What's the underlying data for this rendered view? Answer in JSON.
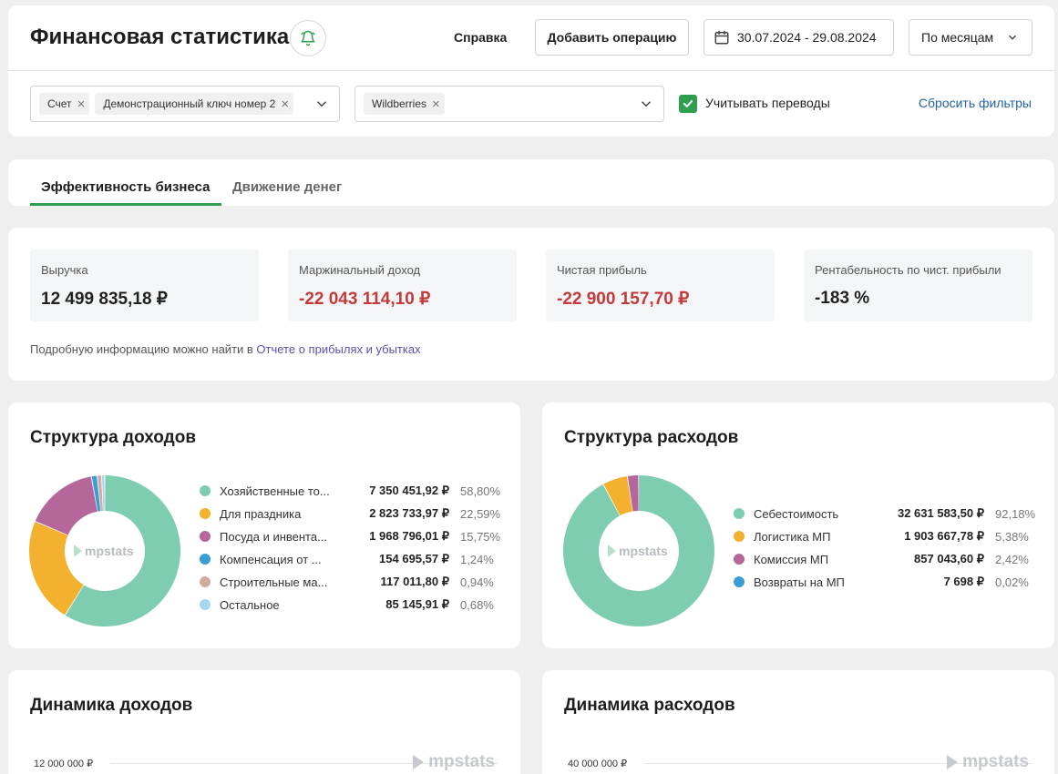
{
  "header": {
    "title": "Финансовая статистика",
    "help_label": "Справка",
    "add_label": "Добавить операцию",
    "date_range": "30.07.2024 - 29.08.2024",
    "period": "По месяцам"
  },
  "filters": {
    "account_tags": [
      "Счет",
      "Демонстрационный ключ номер 2"
    ],
    "marketplace_tags": [
      "Wildberries"
    ],
    "transfers_label": "Учитывать переводы",
    "transfers_checked": true,
    "reset_label": "Сбросить фильтры"
  },
  "tabs": [
    {
      "label": "Эффективность бизнеса",
      "active": true
    },
    {
      "label": "Движение денег",
      "active": false
    }
  ],
  "kpi": [
    {
      "label": "Выручка",
      "value": "12 499 835,18 ₽",
      "negative": false
    },
    {
      "label": "Маржинальный доход",
      "value": "-22 043 114,10 ₽",
      "negative": true
    },
    {
      "label": "Чистая прибыль",
      "value": "-22 900 157,70 ₽",
      "negative": true
    },
    {
      "label": "Рентабельность по чист. прибыли",
      "value": "-183 %",
      "negative": false
    }
  ],
  "kpi_note": {
    "text": "Подробную информацию можно найти в ",
    "link": "Отчете о прибылях и убытках"
  },
  "income_structure": {
    "title": "Структура доходов",
    "watermark": "mpstats",
    "items": [
      {
        "name": "Хозяйственные то...",
        "value": "7 350 451,92 ₽",
        "pct": "58,80%",
        "share": 58.8,
        "color": "#7fcdb0"
      },
      {
        "name": "Для праздника",
        "value": "2 823 733,97 ₽",
        "pct": "22,59%",
        "share": 22.59,
        "color": "#f3b12f"
      },
      {
        "name": "Посуда и инвента...",
        "value": "1 968 796,01 ₽",
        "pct": "15,75%",
        "share": 15.75,
        "color": "#b5679c"
      },
      {
        "name": "Компенсация от ...",
        "value": "154 695,57 ₽",
        "pct": "1,24%",
        "share": 1.24,
        "color": "#3a9dd3"
      },
      {
        "name": "Строительные ма...",
        "value": "117 011,80 ₽",
        "pct": "0,94%",
        "share": 0.94,
        "color": "#d1aba0"
      },
      {
        "name": "Остальное",
        "value": "85 145,91 ₽",
        "pct": "0,68%",
        "share": 0.68,
        "color": "#a9d6f0"
      }
    ]
  },
  "expense_structure": {
    "title": "Структура расходов",
    "watermark": "mpstats",
    "items": [
      {
        "name": "Себестоимость",
        "value": "32 631 583,50 ₽",
        "pct": "92,18%",
        "share": 92.18,
        "color": "#7fcdb0"
      },
      {
        "name": "Логистика МП",
        "value": "1 903 667,78 ₽",
        "pct": "5,38%",
        "share": 5.38,
        "color": "#f3b12f"
      },
      {
        "name": "Комиссия МП",
        "value": "857 043,60 ₽",
        "pct": "2,42%",
        "share": 2.42,
        "color": "#b5679c"
      },
      {
        "name": "Возвраты на МП",
        "value": "7 698 ₽",
        "pct": "0,02%",
        "share": 0.02,
        "color": "#3a9dd3"
      }
    ]
  },
  "income_dynamics": {
    "title": "Динамика доходов",
    "ytick": "12 000 000 ₽",
    "watermark": "mpstats"
  },
  "expense_dynamics": {
    "title": "Динамика расходов",
    "ytick": "40 000 000 ₽",
    "watermark": "mpstats"
  }
}
